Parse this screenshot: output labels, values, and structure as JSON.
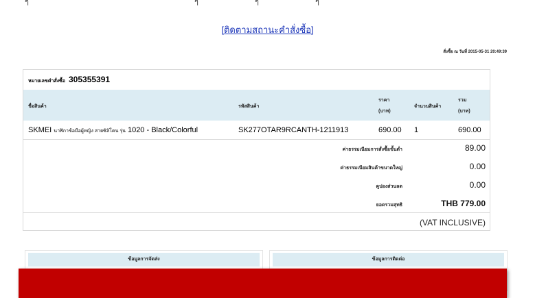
{
  "track_link": "[ติดตามสถานะคำสั่งซื้อ]",
  "order_date": "สั่งซื้อ ณ วันที่ 2015-05-31 20:49:39",
  "order": {
    "number_label": "หมายเลขคำสั่งซื้อ",
    "number": "305355391"
  },
  "table": {
    "headers": {
      "product": "ชื่อสินค้า",
      "sku": "รหัสสินค้า",
      "price_line1": "ราคา",
      "price_line2": "(บาท)",
      "qty": "จำนวนสินค้า",
      "total_line1": "รวม",
      "total_line2": "(บาท)"
    },
    "item": {
      "brand": "SKMEI",
      "desc_thai": "นาฬิกาข้อมือผู้หญิง สายซิลิโคน รุ่น",
      "model": "1020 - Black/Colorful",
      "sku": "SK277OTAR9RCANTH-1211913",
      "price": "690.00",
      "qty": "1",
      "total": "690.00"
    }
  },
  "summary": {
    "service_fee_label": "ค่าธรรมเนียมการสั่งซื้อขั้นต่ำ",
    "service_fee": "89.00",
    "bulky_fee_label": "ค่าธรรมเนียมสินค้าขนาดใหญ่",
    "bulky_fee": "0.00",
    "coupon_label": "คูปองส่วนลด",
    "coupon": "0.00",
    "net_label": "ยอดรวมสุทธิ",
    "net": "THB 779.00",
    "vat": "(VAT INCLUSIVE)"
  },
  "panels": {
    "shipping": "ข้อมูลการจัดส่ง",
    "contact": "ข้อมูลการติดต่อ"
  },
  "colors": {
    "header_bg": "#dcecf3",
    "link": "#1a34b8",
    "bar": "#c10000"
  }
}
